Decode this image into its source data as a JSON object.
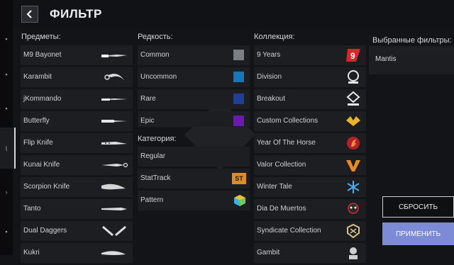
{
  "header": {
    "title": "ФИЛЬТР"
  },
  "columns": {
    "items_title": "Предметы:",
    "rarity_title": "Редкость:",
    "category_title": "Категория:",
    "collection_title": "Коллекция:",
    "selected_title": "Выбранные фильтры:"
  },
  "items": [
    {
      "label": "M9 Bayonet",
      "icon": "bayonet-knife-icon"
    },
    {
      "label": "Karambit",
      "icon": "karambit-knife-icon"
    },
    {
      "label": "jKommando",
      "icon": "jkommando-knife-icon"
    },
    {
      "label": "Butterfly",
      "icon": "butterfly-knife-icon"
    },
    {
      "label": "Flip Knife",
      "icon": "flip-knife-icon"
    },
    {
      "label": "Kunai Knife",
      "icon": "kunai-knife-icon"
    },
    {
      "label": "Scorpion Knife",
      "icon": "scorpion-knife-icon"
    },
    {
      "label": "Tanto",
      "icon": "tanto-knife-icon"
    },
    {
      "label": "Dual Daggers",
      "icon": "dual-daggers-icon"
    },
    {
      "label": "Kukri",
      "icon": "kukri-knife-icon"
    }
  ],
  "rarity": [
    {
      "label": "Common",
      "color": "#7a7f86"
    },
    {
      "label": "Uncommon",
      "color": "#1a74b8"
    },
    {
      "label": "Rare",
      "color": "#1d3f98"
    },
    {
      "label": "Epic",
      "color": "#6b1ab0"
    }
  ],
  "category": [
    {
      "label": "Regular",
      "icon": ""
    },
    {
      "label": "StatTrack",
      "icon": "stattrack-badge-icon",
      "badge": "ST"
    },
    {
      "label": "Pattern",
      "icon": "pattern-cube-icon"
    }
  ],
  "collections": [
    {
      "label": "9 Years",
      "icon": "nine-years-icon"
    },
    {
      "label": "Division",
      "icon": "division-icon"
    },
    {
      "label": "Breakout",
      "icon": "breakout-icon"
    },
    {
      "label": "Custom Collections",
      "icon": "custom-collections-icon"
    },
    {
      "label": "Year Of The Horse",
      "icon": "horse-icon"
    },
    {
      "label": "Valor Collection",
      "icon": "valor-icon"
    },
    {
      "label": "Winter Tale",
      "icon": "snowflake-icon"
    },
    {
      "label": "Dia De Muertos",
      "icon": "skull-icon"
    },
    {
      "label": "Syndicate Collection",
      "icon": "syndicate-icon"
    },
    {
      "label": "Gambit",
      "icon": "gambit-icon"
    }
  ],
  "selected_filters": [
    "Mantis"
  ],
  "buttons": {
    "reset": "СБРОСИТЬ",
    "apply": "ПРИМЕНИТЬ"
  },
  "colors": {
    "accent": "#7d8bd6",
    "panel": "#1d1e22",
    "background": "#131417"
  }
}
